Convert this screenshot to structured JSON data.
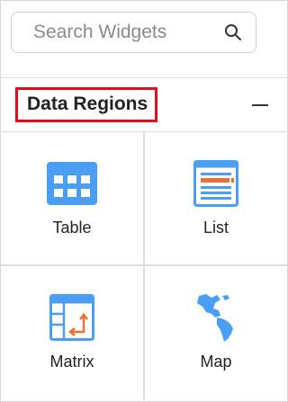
{
  "search": {
    "placeholder": "Search Widgets",
    "value": ""
  },
  "section": {
    "title": "Data Regions",
    "collapse_symbol": "minus-icon"
  },
  "widgets": [
    {
      "label": "Table",
      "icon": "table-icon"
    },
    {
      "label": "List",
      "icon": "list-icon"
    },
    {
      "label": "Matrix",
      "icon": "matrix-icon"
    },
    {
      "label": "Map",
      "icon": "map-icon"
    }
  ],
  "colors": {
    "icon_blue": "#4a9ff5",
    "icon_orange": "#e8703a",
    "highlight_red": "#e0101a"
  }
}
